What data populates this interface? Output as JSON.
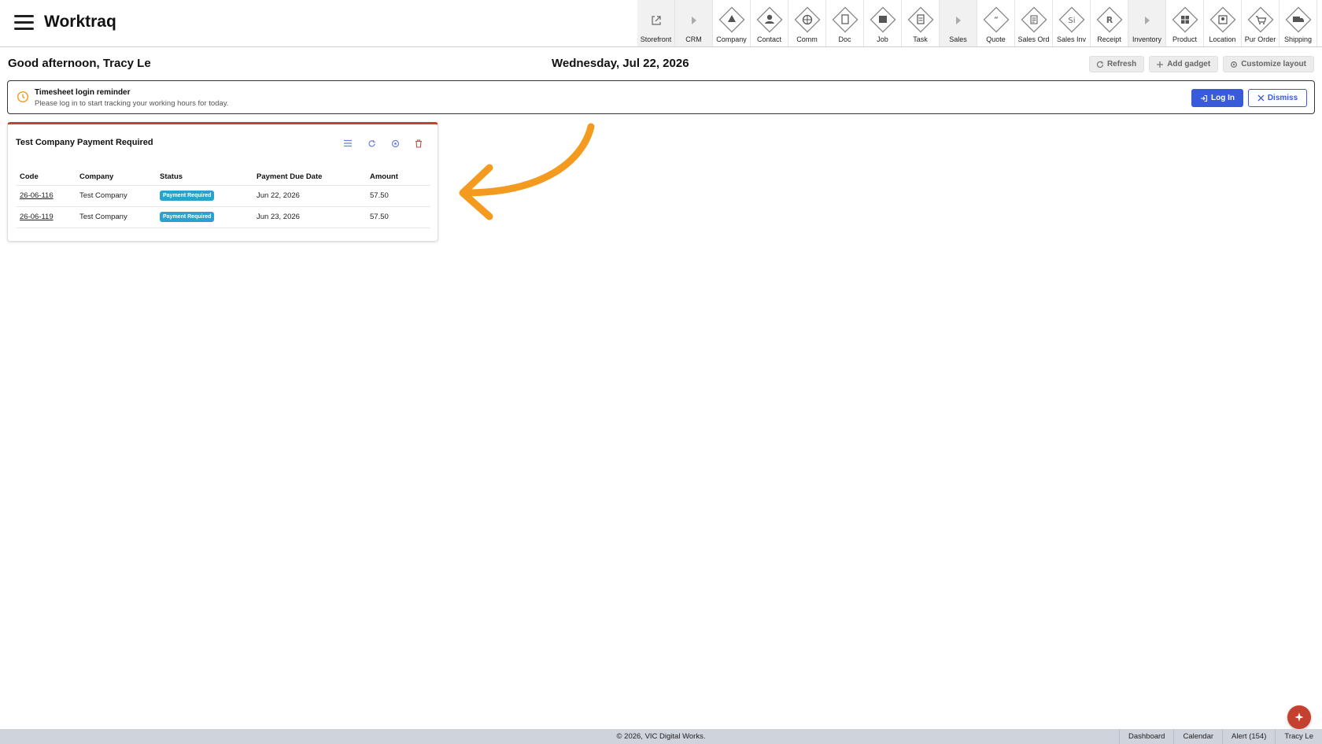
{
  "app": {
    "title": "Worktraq"
  },
  "modules": [
    {
      "label": "Storefront",
      "icon": "external-link-icon",
      "group": true
    },
    {
      "label": "CRM",
      "icon": "caret-right-icon",
      "group": true
    },
    {
      "label": "Company",
      "icon": "company-icon",
      "group": false
    },
    {
      "label": "Contact",
      "icon": "contact-icon",
      "group": false
    },
    {
      "label": "Comm",
      "icon": "comm-icon",
      "group": false
    },
    {
      "label": "Doc",
      "icon": "doc-icon",
      "group": false
    },
    {
      "label": "Job",
      "icon": "job-icon",
      "group": false
    },
    {
      "label": "Task",
      "icon": "task-icon",
      "group": false
    },
    {
      "label": "Sales",
      "icon": "caret-right-icon",
      "group": true
    },
    {
      "label": "Quote",
      "icon": "quote-icon",
      "group": false
    },
    {
      "label": "Sales Ord",
      "icon": "sales-order-icon",
      "group": false
    },
    {
      "label": "Sales Inv",
      "icon": "sales-invoice-icon",
      "group": false
    },
    {
      "label": "Receipt",
      "icon": "receipt-icon",
      "group": false
    },
    {
      "label": "Inventory",
      "icon": "caret-right-icon",
      "group": true
    },
    {
      "label": "Product",
      "icon": "product-icon",
      "group": false
    },
    {
      "label": "Location",
      "icon": "location-icon",
      "group": false
    },
    {
      "label": "Pur Order",
      "icon": "purchase-order-icon",
      "group": false
    },
    {
      "label": "Shipping",
      "icon": "shipping-icon",
      "group": false
    }
  ],
  "header": {
    "greeting": "Good afternoon, Tracy Le",
    "date": "Wednesday, Jul 22, 2026",
    "actions": {
      "refresh": "Refresh",
      "add_gadget": "Add gadget",
      "customize": "Customize layout"
    }
  },
  "reminder": {
    "title": "Timesheet login reminder",
    "text": "Please log in to start tracking your working hours for today.",
    "login_label": "Log In",
    "dismiss_label": "Dismiss"
  },
  "gadget": {
    "title": "Test Company Payment Required",
    "accent": "#c5412f",
    "columns": [
      "Code",
      "Company",
      "Status",
      "Payment Due Date",
      "Amount"
    ],
    "rows": [
      {
        "code": "26-06-116",
        "company": "Test Company",
        "status": "Payment Required",
        "due": "Jun 22, 2026",
        "amount": "57.50"
      },
      {
        "code": "26-06-119",
        "company": "Test Company",
        "status": "Payment Required",
        "due": "Jun 23, 2026",
        "amount": "57.50"
      }
    ]
  },
  "footer": {
    "copyright": "© 2026, VIC Digital Works.",
    "links": [
      "Dashboard",
      "Calendar",
      "Alert (154)",
      "Tracy Le"
    ]
  },
  "colors": {
    "primary": "#3a5bd9",
    "badge": "#2aa2d0",
    "annotation_arrow": "#f39a1f",
    "danger": "#c5412f"
  }
}
